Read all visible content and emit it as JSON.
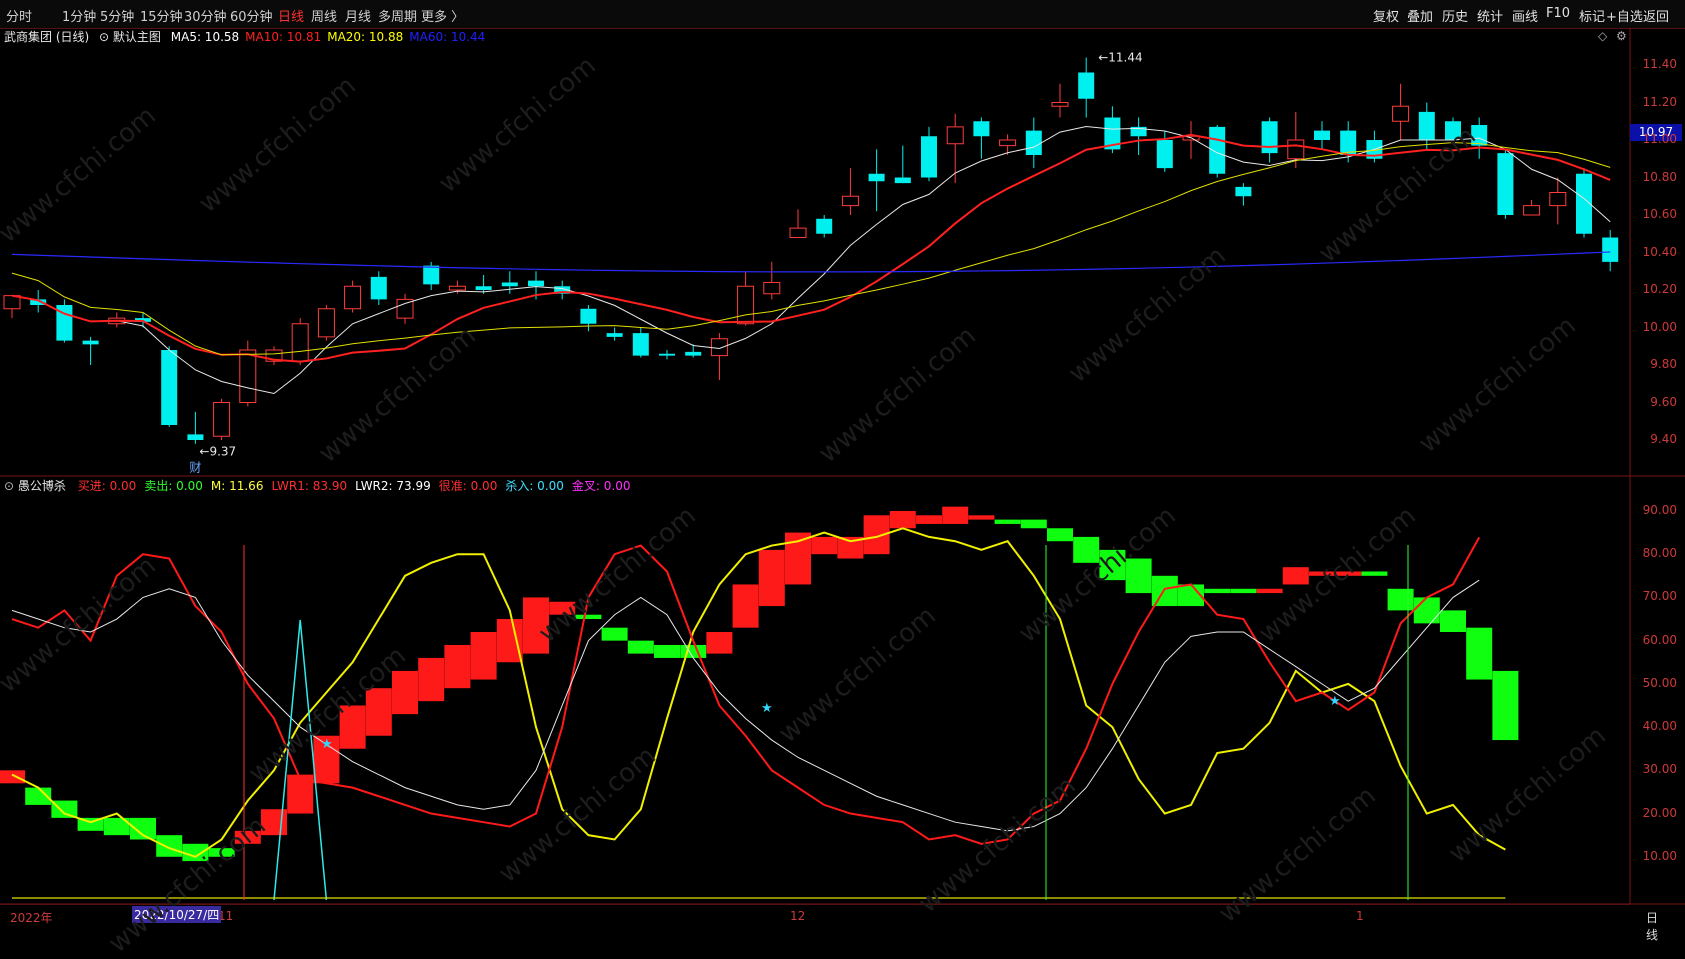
{
  "toolbar": {
    "periods": [
      "分时",
      "1分钟",
      "5分钟",
      "15分钟",
      "30分钟",
      "60分钟",
      "日线",
      "周线",
      "月线",
      "多周期",
      "更多 〉"
    ],
    "active": "日线",
    "right": [
      "复权",
      "叠加",
      "历史",
      "统计",
      "画线",
      "F10",
      "+自选",
      "返回"
    ],
    "right_extra": "标记"
  },
  "main": {
    "title": "武商集团 (日线)",
    "chart_name": "默认主图",
    "ma": [
      {
        "label": "MA5: 10.58",
        "color": "#ffffff"
      },
      {
        "label": "MA10: 10.81",
        "color": "#ff2020"
      },
      {
        "label": "MA20: 10.88",
        "color": "#ffff00"
      },
      {
        "label": "MA60: 10.44",
        "color": "#2020ff"
      }
    ],
    "high_label": "11.44",
    "low_label": "9.37",
    "fin_marker": "财",
    "last_price": "10.97",
    "y_ticks": [
      "11.40",
      "11.20",
      "11.00",
      "10.80",
      "10.60",
      "10.40",
      "10.20",
      "10.00",
      "9.80",
      "9.60",
      "9.40"
    ]
  },
  "sub": {
    "name": "愚公博杀",
    "legend": [
      {
        "label": "买进: 0.00",
        "color": "#ff3030"
      },
      {
        "label": "卖出: 0.00",
        "color": "#30ff30"
      },
      {
        "label": "M: 11.66",
        "color": "#ffff40"
      },
      {
        "label": "LWR1: 83.90",
        "color": "#ff3030"
      },
      {
        "label": "LWR2: 73.99",
        "color": "#ffffff"
      },
      {
        "label": "很准: 0.00",
        "color": "#ff3030"
      },
      {
        "label": "杀入: 0.00",
        "color": "#40e0ff"
      },
      {
        "label": "金叉: 0.00",
        "color": "#ff30ff"
      }
    ],
    "y_ticks": [
      "90.00",
      "80.00",
      "70.00",
      "60.00",
      "50.00",
      "40.00",
      "30.00",
      "20.00",
      "10.00"
    ]
  },
  "xaxis": {
    "labels": [
      "2022年",
      "11",
      "12",
      "1"
    ],
    "cursor_date": "2022/10/27/四",
    "period": "日线"
  },
  "watermark": "www.cfchi.com",
  "chart_data": {
    "type": "candlestick",
    "series_candles": [
      [
        10.1,
        10.17,
        10.05,
        10.13
      ],
      [
        10.15,
        10.12,
        10.2,
        10.08
      ],
      [
        10.12,
        9.93,
        10.15,
        9.92
      ],
      [
        9.93,
        9.91,
        9.95,
        9.8
      ],
      [
        10.02,
        10.05,
        10.08,
        10.0
      ],
      [
        10.05,
        10.03,
        10.08,
        10.0
      ],
      [
        9.88,
        9.48,
        9.9,
        9.47
      ],
      [
        9.43,
        9.4,
        9.55,
        9.38
      ],
      [
        9.42,
        9.6,
        9.62,
        9.4
      ],
      [
        9.6,
        9.88,
        9.93,
        9.58
      ],
      [
        9.82,
        9.88,
        9.9,
        9.8
      ],
      [
        9.82,
        10.02,
        10.05,
        9.8
      ],
      [
        9.95,
        10.1,
        10.12,
        9.93
      ],
      [
        10.1,
        10.22,
        10.25,
        10.08
      ],
      [
        10.27,
        10.15,
        10.3,
        10.12
      ],
      [
        10.05,
        10.15,
        10.18,
        10.02
      ],
      [
        10.33,
        10.23,
        10.35,
        10.2
      ],
      [
        10.2,
        10.22,
        10.25,
        10.18
      ],
      [
        10.22,
        10.2,
        10.28,
        10.18
      ],
      [
        10.24,
        10.22,
        10.3,
        10.18
      ],
      [
        10.25,
        10.22,
        10.3,
        10.15
      ],
      [
        10.22,
        10.18,
        10.25,
        10.15
      ],
      [
        10.1,
        10.02,
        10.12,
        9.98
      ],
      [
        9.97,
        9.95,
        10.0,
        9.93
      ],
      [
        9.97,
        9.85,
        10.0,
        9.84
      ],
      [
        9.86,
        9.85,
        9.88,
        9.83
      ],
      [
        9.87,
        9.85,
        9.91,
        9.84
      ],
      [
        9.85,
        9.94,
        9.97,
        9.72
      ],
      [
        10.02,
        10.22,
        10.3,
        10.01
      ],
      [
        10.18,
        10.24,
        10.35,
        10.15
      ],
      [
        10.48,
        10.53,
        10.63,
        10.48
      ],
      [
        10.58,
        10.5,
        10.6,
        10.48
      ],
      [
        10.65,
        10.7,
        10.85,
        10.6
      ],
      [
        10.82,
        10.78,
        10.95,
        10.62
      ],
      [
        10.8,
        10.77,
        10.97,
        10.77
      ],
      [
        11.02,
        10.8,
        11.07,
        10.78
      ],
      [
        10.98,
        11.07,
        11.14,
        10.77
      ],
      [
        11.1,
        11.02,
        11.12,
        10.9
      ],
      [
        10.97,
        11.0,
        11.03,
        10.92
      ],
      [
        11.05,
        10.92,
        11.12,
        10.85
      ],
      [
        11.18,
        11.2,
        11.3,
        11.12
      ],
      [
        11.36,
        11.22,
        11.44,
        11.12
      ],
      [
        11.12,
        10.95,
        11.18,
        10.93
      ],
      [
        11.07,
        11.02,
        11.12,
        10.92
      ],
      [
        11.0,
        10.85,
        11.05,
        10.83
      ],
      [
        11.0,
        11.02,
        11.1,
        10.9
      ],
      [
        11.07,
        10.82,
        11.08,
        10.8
      ],
      [
        10.75,
        10.7,
        10.77,
        10.65
      ],
      [
        11.1,
        10.93,
        11.12,
        10.88
      ],
      [
        10.9,
        11.0,
        11.15,
        10.85
      ],
      [
        11.05,
        11.0,
        11.1,
        10.95
      ],
      [
        11.05,
        10.92,
        11.1,
        10.88
      ],
      [
        11.0,
        10.9,
        11.05,
        10.88
      ],
      [
        11.1,
        11.18,
        11.3,
        11.0
      ],
      [
        11.15,
        11.0,
        11.2,
        10.95
      ],
      [
        11.1,
        11.0,
        11.12,
        11.0
      ],
      [
        11.08,
        10.97,
        11.12,
        10.9
      ],
      [
        10.93,
        10.6,
        10.95,
        10.58
      ],
      [
        10.6,
        10.65,
        10.68,
        10.6
      ],
      [
        10.65,
        10.72,
        10.8,
        10.55
      ],
      [
        10.82,
        10.5,
        10.85,
        10.48
      ],
      [
        10.48,
        10.35,
        10.52,
        10.3
      ]
    ]
  }
}
